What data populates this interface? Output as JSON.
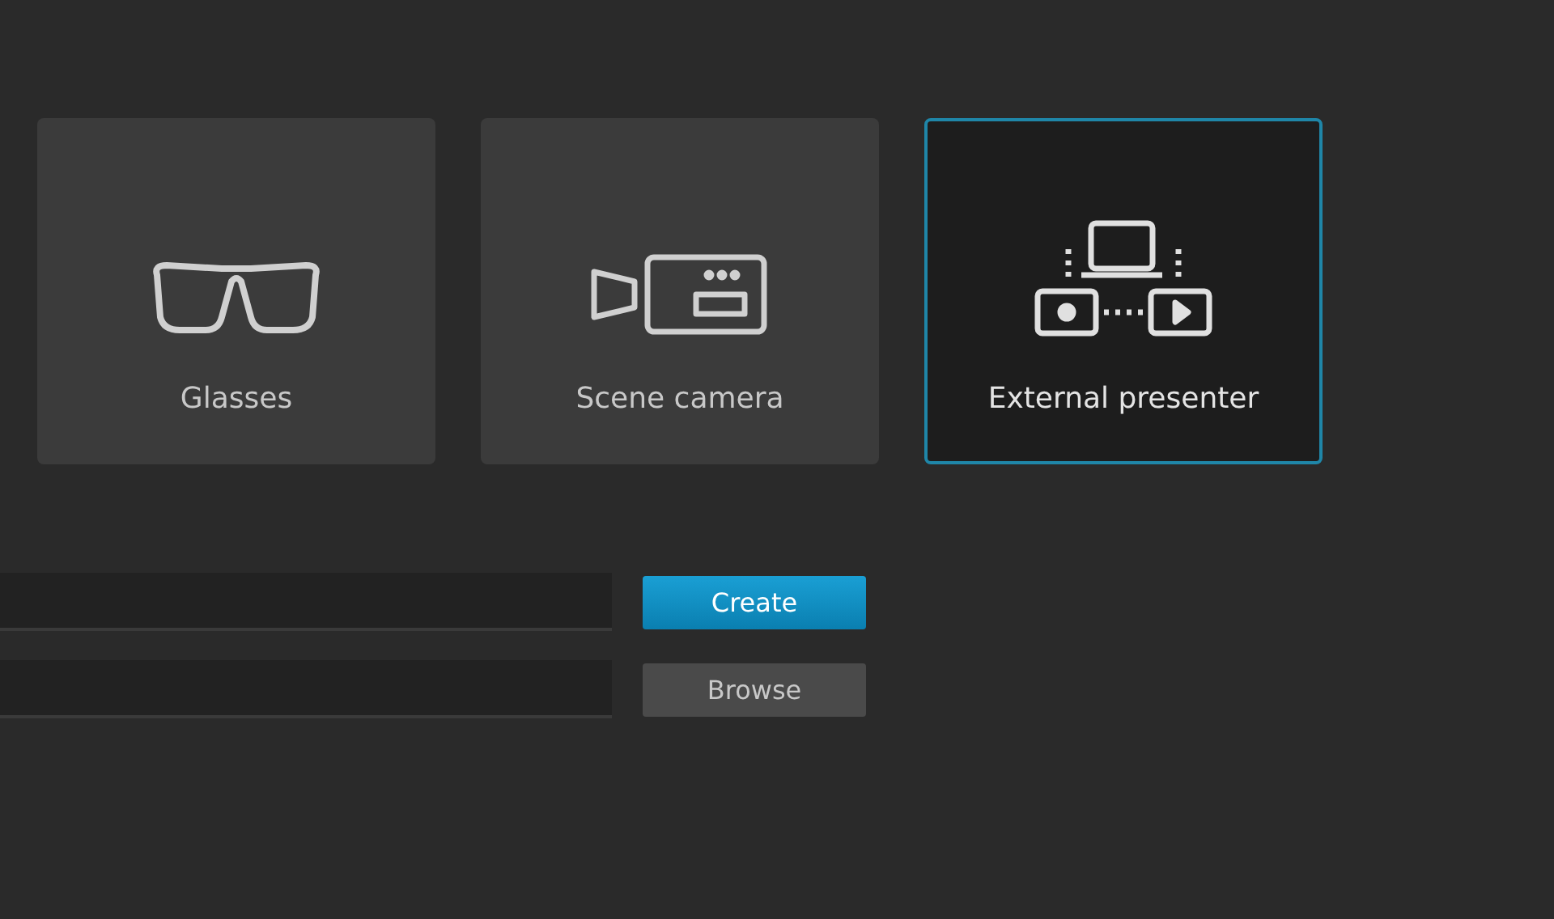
{
  "options": [
    {
      "kind": "glasses",
      "label": "Glasses",
      "selected": false
    },
    {
      "kind": "camera",
      "label": "Scene camera",
      "selected": false
    },
    {
      "kind": "presenter",
      "label": "External presenter",
      "selected": true
    }
  ],
  "rows": [
    {
      "button": {
        "label": "Create",
        "kind": "primary"
      }
    },
    {
      "button": {
        "label": "Browse",
        "kind": "secondary"
      }
    }
  ]
}
